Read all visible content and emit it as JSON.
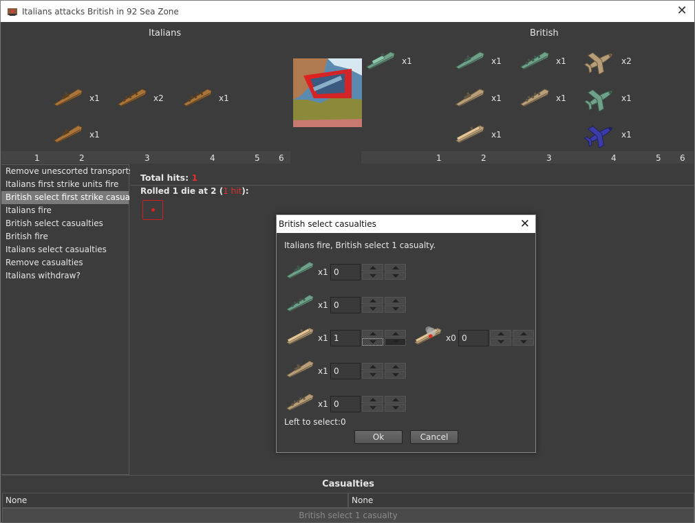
{
  "window": {
    "title": "Italians attacks British in 92 Sea Zone",
    "close_glyph": "✕"
  },
  "battle": {
    "attacker": "Italians",
    "defender": "British",
    "attacker_units": [
      {
        "kind": "destroyer",
        "color": "#a8743a",
        "count": "x1"
      },
      {
        "kind": "cruiser",
        "color": "#a8743a",
        "count": "x2"
      },
      {
        "kind": "battleship",
        "color": "#a8743a",
        "count": "x1"
      },
      {
        "kind": "destroyer",
        "color": "#a8743a",
        "count": "x1"
      }
    ],
    "defender_units": [
      {
        "kind": "transport",
        "color": "#6fa08a",
        "count": "x1"
      },
      {
        "kind": "destroyer",
        "color": "#6fa08a",
        "count": "x1"
      },
      {
        "kind": "battleship",
        "color": "#6fa08a",
        "count": "x1"
      },
      {
        "kind": "fighter",
        "color": "#b89e78",
        "count": "x2"
      },
      {
        "kind": "destroyer",
        "color": "#b89e78",
        "count": "x1"
      },
      {
        "kind": "cruiser",
        "color": "#b89e78",
        "count": "x1"
      },
      {
        "kind": "fighter",
        "color": "#6fa08a",
        "count": "x1"
      },
      {
        "kind": "carrier",
        "color": "#b89e78",
        "count": "x1"
      },
      {
        "kind": "fighter",
        "color": "#3c3ca8",
        "count": "x1"
      }
    ],
    "column_numbers": [
      "1",
      "2",
      "3",
      "4",
      "5",
      "6"
    ]
  },
  "steps": [
    "Remove unescorted transports",
    "Italians first strike units fire",
    "British select first strike casualties",
    "Italians fire",
    "British select casualties",
    "British fire",
    "Italians select casualties",
    "Remove casualties",
    "Italians withdraw?"
  ],
  "selected_step": 2,
  "hits": {
    "total_label": "Total hits:",
    "total_value": "1",
    "rolled_prefix": "Rolled 1 die at 2 (",
    "rolled_hit": "1 hit",
    "rolled_suffix": "):"
  },
  "casualties": {
    "title": "Casualties",
    "attacker": "None",
    "defender": "None"
  },
  "status": "British select 1 casualty",
  "dialog": {
    "title": "British select casualties",
    "message": "Italians fire,  British select 1 casualty.",
    "rows": [
      {
        "kind": "destroyer",
        "color": "#6fa08a",
        "count": "x1",
        "value": "0"
      },
      {
        "kind": "battleship",
        "color": "#6fa08a",
        "count": "x1",
        "value": "0"
      },
      {
        "kind": "carrier",
        "color": "#b89e78",
        "count": "x1",
        "value": "1",
        "damaged_count": "x0",
        "damaged_value": "0"
      },
      {
        "kind": "destroyer",
        "color": "#b89e78",
        "count": "x1",
        "value": "0"
      },
      {
        "kind": "cruiser",
        "color": "#b89e78",
        "count": "x1",
        "value": "0"
      }
    ],
    "left_to_select": "Left to select:0",
    "ok": "Ok",
    "cancel": "Cancel"
  }
}
